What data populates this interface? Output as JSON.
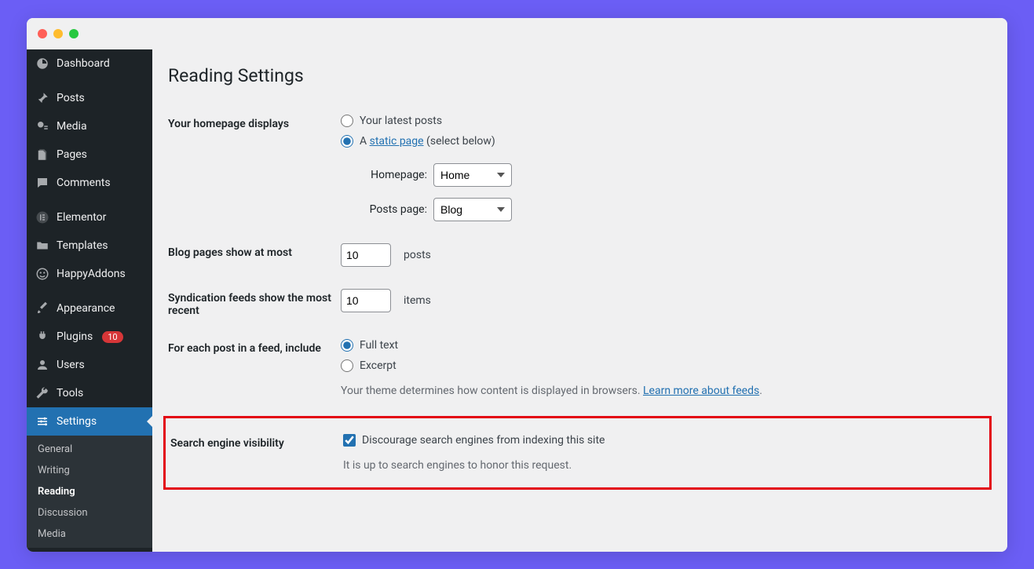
{
  "sidebar": {
    "dashboard": "Dashboard",
    "posts": "Posts",
    "media": "Media",
    "pages": "Pages",
    "comments": "Comments",
    "elementor": "Elementor",
    "templates": "Templates",
    "happyaddons": "HappyAddons",
    "appearance": "Appearance",
    "plugins": "Plugins",
    "plugins_badge": "10",
    "users": "Users",
    "tools": "Tools",
    "settings": "Settings",
    "submenu": {
      "general": "General",
      "writing": "Writing",
      "reading": "Reading",
      "discussion": "Discussion",
      "media": "Media"
    }
  },
  "page": {
    "title": "Reading Settings",
    "homepage_label": "Your homepage displays",
    "opt_latest": "Your latest posts",
    "opt_static_prefix": "A ",
    "opt_static_link": "static page",
    "opt_static_suffix": " (select below)",
    "homepage_select_label": "Homepage:",
    "homepage_value": "Home",
    "postspage_select_label": "Posts page:",
    "postspage_value": "Blog",
    "blog_pages_label": "Blog pages show at most",
    "blog_pages_value": "10",
    "blog_pages_unit": "posts",
    "syndication_label": "Syndication feeds show the most recent",
    "syndication_value": "10",
    "syndication_unit": "items",
    "feed_label": "For each post in a feed, include",
    "feed_full": "Full text",
    "feed_excerpt": "Excerpt",
    "feed_desc_prefix": "Your theme determines how content is displayed in browsers. ",
    "feed_desc_link": "Learn more about feeds",
    "feed_desc_suffix": ".",
    "sev_label": "Search engine visibility",
    "sev_check": "Discourage search engines from indexing this site",
    "sev_desc": "It is up to search engines to honor this request."
  }
}
